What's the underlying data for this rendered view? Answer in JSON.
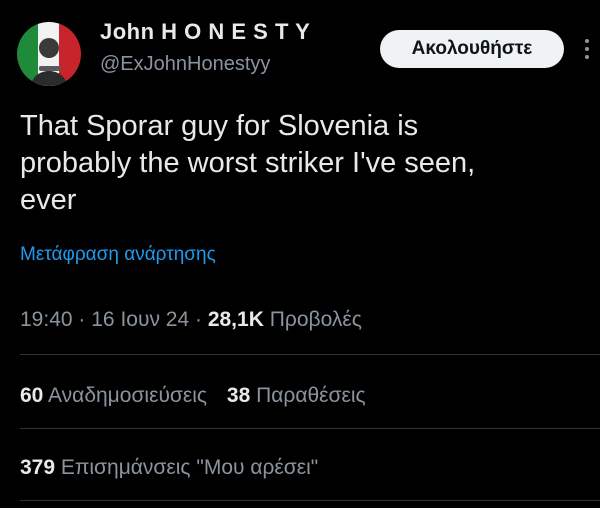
{
  "author": {
    "display_name": "John H O N E S T Y",
    "handle": "@ExJohnHonestyy",
    "avatar_icon": "profile-photo-avatar"
  },
  "follow_button": {
    "label": "Ακολουθήστε"
  },
  "more_icon": "more-options-icon",
  "tweet": {
    "text_lines": [
      "That Sporar guy for Slovenia is",
      "probably the worst striker I've seen,",
      "ever"
    ],
    "translate_label": "Μετάφραση ανάρτησης"
  },
  "meta": {
    "time": "19:40",
    "separator": "·",
    "date": "16 Ιουν 24",
    "views_count": "28,1K",
    "views_label": "Προβολές"
  },
  "stats": {
    "reposts_count": "60",
    "reposts_label": "Αναδημοσιεύσεις",
    "quotes_count": "38",
    "quotes_label": "Παραθέσεις",
    "bookmarks_count": "379",
    "bookmarks_label": "Επισημάνσεις \"Μου αρέσει\""
  },
  "colors": {
    "background": "#000000",
    "text": "#e7e9ea",
    "muted": "#8b949e",
    "link": "#1d9bf0",
    "divider": "#2f3336",
    "button_bg": "#eff3f4"
  }
}
